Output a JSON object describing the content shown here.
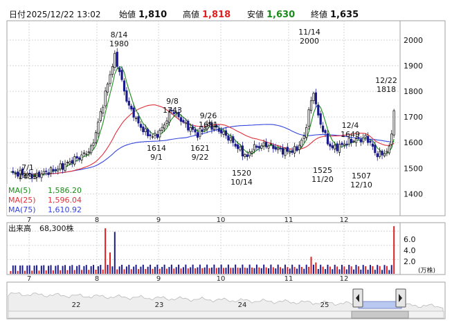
{
  "header": {
    "date_label": "日付",
    "datetime": "2025/12/22 13:02",
    "open_label": "始値",
    "open": "1,810",
    "high_label": "高値",
    "high": "1,818",
    "low_label": "安値",
    "low": "1,630",
    "close_label": "終値",
    "close": "1,635"
  },
  "colors": {
    "up": "#1a1a1a",
    "down": "#1a1a8c",
    "ma5": "#1a8c1a",
    "ma25": "#e0303a",
    "ma75": "#3344dd",
    "vol_up": "#e02020",
    "vol_down": "#1a1a8c",
    "grid": "#d6d6d6",
    "frame": "#a0a0a0",
    "navigator_fill": "#b8c8f0"
  },
  "chart_data": [
    {
      "type": "candlestick",
      "name": "price",
      "x_month_ticks": [
        "7",
        "8",
        "9",
        "10",
        "11",
        "12"
      ],
      "y_ticks": [
        1400,
        1500,
        1600,
        1700,
        1800,
        1900,
        2000
      ],
      "ylim": [
        1320,
        2070
      ],
      "ma_legend": [
        {
          "label": "MA(5)",
          "value": "1,586.20"
        },
        {
          "label": "MA(25)",
          "value": "1,596.04"
        },
        {
          "label": "MA(75)",
          "value": "1,610.92"
        }
      ],
      "annotations": [
        {
          "date": "7/1",
          "value": "1483"
        },
        {
          "date": "8/14",
          "value": "1980"
        },
        {
          "date": "9/1",
          "value": "1614"
        },
        {
          "date": "9/8",
          "value": "1743"
        },
        {
          "date": "9/22",
          "value": "1621"
        },
        {
          "date": "9/26",
          "value": "1681"
        },
        {
          "date": "10/14",
          "value": "1520"
        },
        {
          "date": "11/14",
          "value": "2000"
        },
        {
          "date": "11/20",
          "value": "1525"
        },
        {
          "date": "12/4",
          "value": "1649"
        },
        {
          "date": "12/10",
          "value": "1507"
        },
        {
          "date": "12/22",
          "value": "1818"
        }
      ]
    },
    {
      "type": "bar",
      "name": "volume",
      "title": "出来高",
      "latest": "68,300株",
      "y_ticks": [
        "6.0",
        "4.0",
        "2.0"
      ],
      "unit": "(万株)",
      "ylim": [
        0,
        7
      ]
    },
    {
      "type": "area",
      "name": "navigator",
      "x_ticks": [
        "22",
        "23",
        "24",
        "25"
      ]
    }
  ]
}
